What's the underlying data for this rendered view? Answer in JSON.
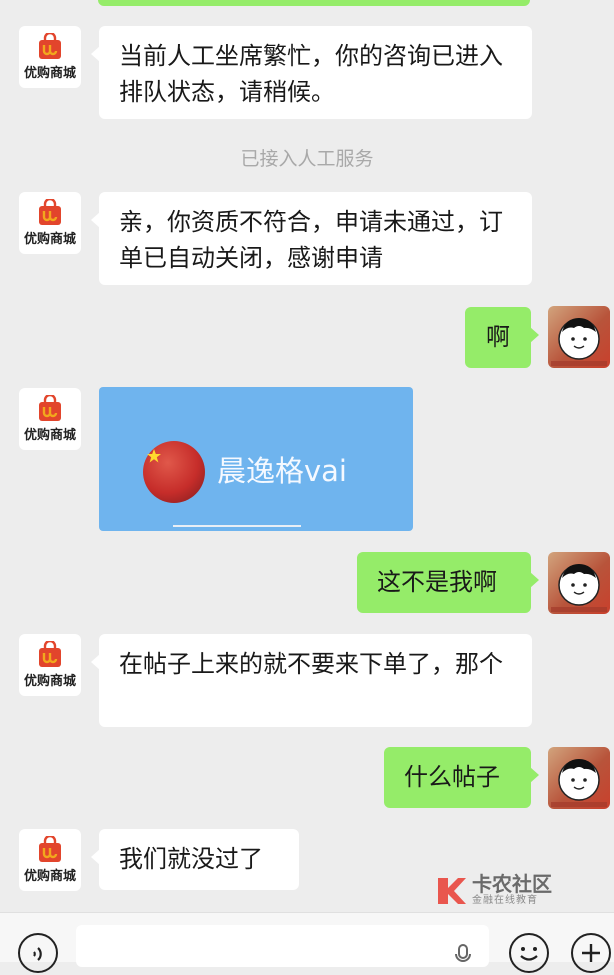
{
  "shop": {
    "name": "优购商城"
  },
  "system_notice": "已接入人工服务",
  "messages": [
    {
      "from": "shop",
      "text": "当前人工坐席繁忙，你的咨询已进入排队状态，请稍候。"
    },
    {
      "from": "shop",
      "text": "亲，你资质不符合，申请未通过，订单已自动关闭，感谢申请"
    },
    {
      "from": "user",
      "text": "啊"
    },
    {
      "from": "shop",
      "type": "image",
      "caption": "晨逸格vai"
    },
    {
      "from": "user",
      "text": "这不是我啊"
    },
    {
      "from": "shop",
      "text": "在帖子上来的就不要来下单了，那个"
    },
    {
      "from": "user",
      "text": "什么帖子"
    },
    {
      "from": "shop",
      "text": "我们就没过了"
    }
  ],
  "watermark": {
    "title": "卡农社区",
    "subtitle": "金融在线教育"
  },
  "colors": {
    "background": "#ededed",
    "user_bubble": "#95ec69",
    "shop_bubble": "#ffffff"
  },
  "icons": [
    "voice-icon",
    "microphone-icon",
    "emoji-icon",
    "plus-icon"
  ]
}
